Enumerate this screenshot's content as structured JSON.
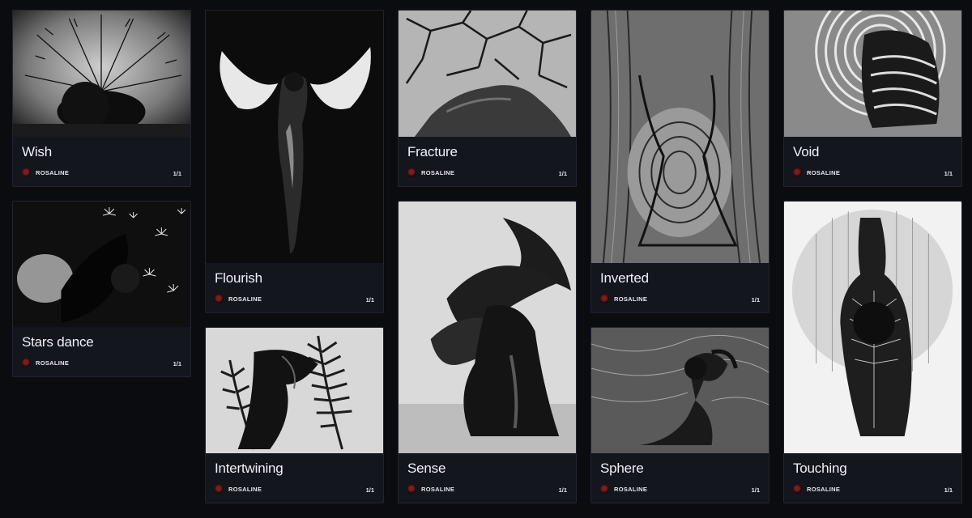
{
  "creator": "ROSALINE",
  "cards": [
    {
      "title": "Wish",
      "edition": "1/1",
      "image": "dandelion-figure-photo"
    },
    {
      "title": "Stars dance",
      "edition": "1/1",
      "image": "seed-stars-figure-photo"
    },
    {
      "title": "Flourish",
      "edition": "1/1",
      "image": "horned-light-figure-photo"
    },
    {
      "title": "Intertwining",
      "edition": "1/1",
      "image": "fern-shadow-figure-photo"
    },
    {
      "title": "Fracture",
      "edition": "1/1",
      "image": "cracked-earth-figure-photo"
    },
    {
      "title": "Sense",
      "edition": "1/1",
      "image": "monstera-leaf-figure-photo"
    },
    {
      "title": "Inverted",
      "edition": "1/1",
      "image": "wood-grain-figure-photo"
    },
    {
      "title": "Sphere",
      "edition": "1/1",
      "image": "textured-sphere-figure-photo"
    },
    {
      "title": "Void",
      "edition": "1/1",
      "image": "spiral-rings-figure-photo"
    },
    {
      "title": "Touching",
      "edition": "1/1",
      "image": "leaf-vein-figure-photo"
    }
  ]
}
